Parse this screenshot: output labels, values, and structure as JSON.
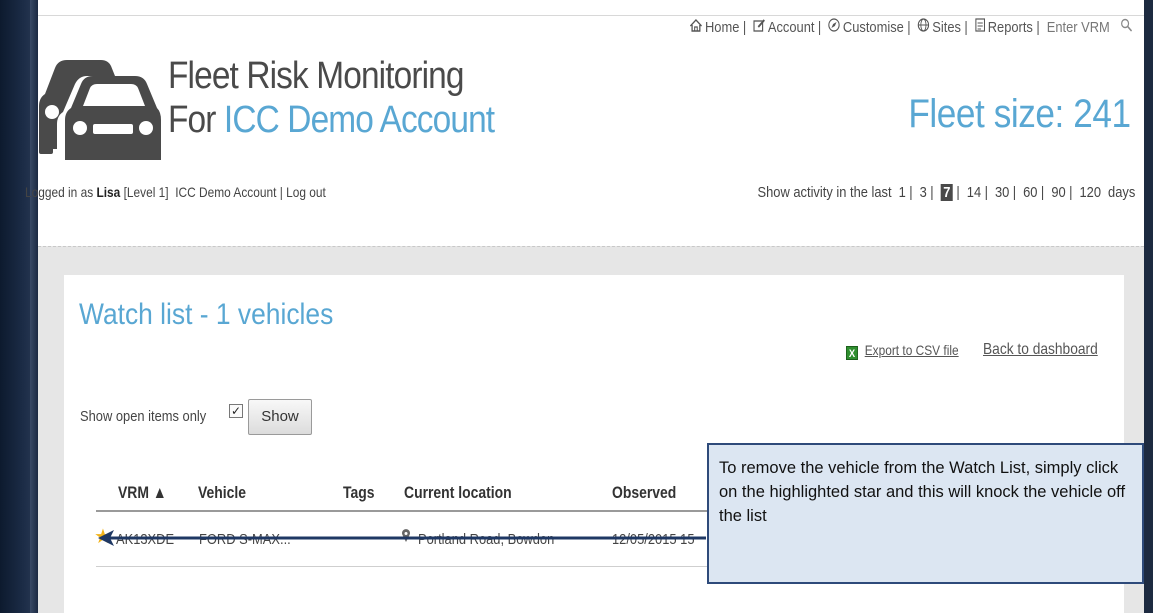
{
  "brand": {
    "title_line1": "Fleet Risk Monitoring",
    "title_prefix": "For ",
    "account_name": "ICC Demo Account"
  },
  "topnav": {
    "home": "Home",
    "account": "Account",
    "customise": "Customise",
    "sites": "Sites",
    "reports": "Reports",
    "enter_vrm": "Enter VRM"
  },
  "fleet": {
    "label": "Fleet size: 241"
  },
  "session": {
    "prefix": "Logged in as ",
    "user": "Lisa",
    "level": " [Level 1]",
    "account": "ICC Demo Account",
    "logout": "Log out"
  },
  "activity": {
    "label": "Show activity in the last",
    "options": [
      "1",
      "3",
      "7",
      "14",
      "30",
      "60",
      "90",
      "120"
    ],
    "selected": "7",
    "unit": "days"
  },
  "watchlist": {
    "title": "Watch list - 1 vehicles",
    "export_label": "Export to CSV file",
    "back_label": "Back to dashboard",
    "filter_label": "Show open items only",
    "filter_checked": true,
    "show_button": "Show",
    "columns": {
      "vrm": "VRM ▲",
      "vehicle": "Vehicle",
      "tags": "Tags",
      "location": "Current location",
      "observed": "Observed"
    },
    "rows": [
      {
        "vrm": "AK13XDE",
        "vehicle": "FORD S-MAX...",
        "tags": "",
        "location": "Portland Road, Bowdon",
        "observed": "12/05/2015 15"
      }
    ]
  },
  "callout": {
    "text": "To remove the vehicle from the Watch List, simply click on the highlighted star and this will knock the vehicle off the list"
  },
  "colors": {
    "accent": "#59a7d3",
    "star": "#f2b31a",
    "callout_bg": "#dce6f2",
    "callout_border": "#2e4a7a",
    "arrow": "#1f3864"
  },
  "icons": [
    "home-icon",
    "edit-icon",
    "compass-icon",
    "globe-icon",
    "report-icon",
    "search-icon",
    "excel-icon",
    "star-icon",
    "location-pin-icon",
    "car-logo-icon"
  ]
}
